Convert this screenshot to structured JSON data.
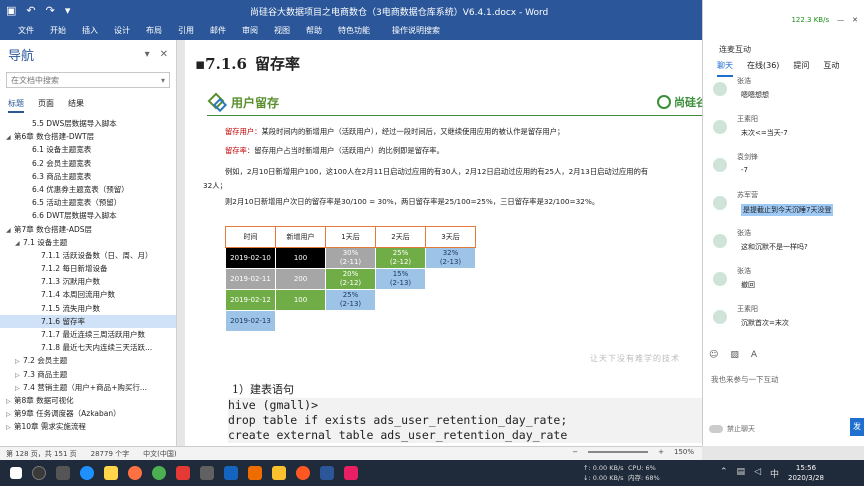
{
  "window": {
    "title": "尚硅谷大数据项目之电商数仓（3电商数据仓库系统）V6.4.1.docx  -  Word"
  },
  "ribbon": {
    "tabs": [
      "文件",
      "开始",
      "插入",
      "设计",
      "布局",
      "引用",
      "邮件",
      "审阅",
      "视图",
      "帮助",
      "特色功能"
    ],
    "tell_me": "操作说明搜索"
  },
  "nav": {
    "title": "导航",
    "search_placeholder": "在文档中搜索",
    "tabs": [
      "标题",
      "页面",
      "结果"
    ],
    "items": [
      {
        "label": "5.5 DWS层数据导入脚本",
        "indent": 2,
        "tri": ""
      },
      {
        "label": "第6章 数仓搭建-DWT层",
        "indent": 0,
        "tri": "◢"
      },
      {
        "label": "6.1 设备主题宽表",
        "indent": 2,
        "tri": ""
      },
      {
        "label": "6.2 会员主题宽表",
        "indent": 2,
        "tri": ""
      },
      {
        "label": "6.3 商品主题宽表",
        "indent": 2,
        "tri": ""
      },
      {
        "label": "6.4 优惠券主题宽表（预留）",
        "indent": 2,
        "tri": ""
      },
      {
        "label": "6.5 活动主题宽表（预留）",
        "indent": 2,
        "tri": ""
      },
      {
        "label": "6.6 DWT层数据导入脚本",
        "indent": 2,
        "tri": ""
      },
      {
        "label": "第7章 数仓搭建-ADS层",
        "indent": 0,
        "tri": "◢"
      },
      {
        "label": "7.1 设备主题",
        "indent": 1,
        "tri": "◢"
      },
      {
        "label": "7.1.1 活跃设备数（日、周、月）",
        "indent": 3,
        "tri": ""
      },
      {
        "label": "7.1.2 每日新增设备",
        "indent": 3,
        "tri": ""
      },
      {
        "label": "7.1.3 沉默用户数",
        "indent": 3,
        "tri": ""
      },
      {
        "label": "7.1.4 本周回流用户数",
        "indent": 3,
        "tri": ""
      },
      {
        "label": "7.1.5 流失用户数",
        "indent": 3,
        "tri": ""
      },
      {
        "label": "7.1.6 留存率",
        "indent": 3,
        "tri": "",
        "selected": true
      },
      {
        "label": "7.1.7 最近连续三周活跃用户数",
        "indent": 3,
        "tri": ""
      },
      {
        "label": "7.1.8 最近七天内连续三天活跃...",
        "indent": 3,
        "tri": ""
      },
      {
        "label": "7.2 会员主题",
        "indent": 1,
        "tri": "▷"
      },
      {
        "label": "7.3 商品主题",
        "indent": 1,
        "tri": "▷"
      },
      {
        "label": "7.4 营销主题（用户+商品+购买行...",
        "indent": 1,
        "tri": "▷"
      },
      {
        "label": "第8章 数据可视化",
        "indent": 0,
        "tri": "▷"
      },
      {
        "label": "第9章 任务调度器（Azkaban）",
        "indent": 0,
        "tri": "▷"
      },
      {
        "label": "第10章 需求实施流程",
        "indent": 0,
        "tri": "▷"
      }
    ]
  },
  "doc": {
    "heading_num": "7.1.6",
    "heading_text": "留存率",
    "banner_title": "用户留存",
    "logo_text": "尚硅谷",
    "p1_term": "留存用户：",
    "p1_text": "某段时间内的新增用户（活跃用户），经过一段时间后，又继续使用应用的被认作是留存用户；",
    "p2_term": "留存率：",
    "p2_text": "留存用户占当时新增用户（活跃用户）的比例即是留存率。",
    "p3a": "例如，2月10日新增用户100，这100人在2月11日启动过应用的有30人，2月12日启动过应用的有25人，2月13日启动过应用的有",
    "p3b": "32人；",
    "p4": "则2月10日新增用户次日的留存率是30/100 = 30%，两日留存率是25/100=25%，三日留存率是32/100=32%。",
    "table_headers": [
      "时间",
      "新增用户",
      "1天后",
      "2天后",
      "3天后"
    ],
    "table_rows": [
      {
        "date": "2019-02-10",
        "new": "100",
        "d1": "30%\n(2-11)",
        "d2": "25%\n(2-12)",
        "d3": "32%\n(2-13)"
      },
      {
        "date": "2019-02-11",
        "new": "200",
        "d1": "20%\n(2-12)",
        "d2": "15%\n(2-13)",
        "d3": ""
      },
      {
        "date": "2019-02-12",
        "new": "100",
        "d1": "25%\n(2-13)",
        "d2": "",
        "d3": ""
      },
      {
        "date": "2019-02-13",
        "new": "",
        "d1": "",
        "d2": "",
        "d3": ""
      }
    ],
    "watermark": "让天下没有难学的技术",
    "section": "1）建表语句",
    "code": [
      "hive (gmall)>",
      "drop table if exists ads_user_retention_day_rate;",
      "create external table ads_user_retention_day_rate"
    ]
  },
  "chat": {
    "net_speed": "122.3 KB/s",
    "title": "连麦互动",
    "tabs": [
      "聊天",
      "在线(36)",
      "提问",
      "互动"
    ],
    "messages": [
      {
        "who": "张浩",
        "text": "嗯嗯想想",
        "hl": false
      },
      {
        "who": "王素阳",
        "text": "末次<=当天-7",
        "hl": false
      },
      {
        "who": "袁剑锋",
        "text": "-7",
        "hl": false
      },
      {
        "who": "苏军营",
        "text": "是提截止到今天沉睡7天没登",
        "hl": true
      },
      {
        "who": "张浩",
        "text": "这和沉默不是一样吗?",
        "hl": false
      },
      {
        "who": "张浩",
        "text": "撤回",
        "hl": false
      },
      {
        "who": "王素阳",
        "text": "沉默首次=末次",
        "hl": false
      }
    ],
    "input_placeholder": "我也来参与一下互动",
    "mute_label": "禁止聊天",
    "send": "发"
  },
  "status": {
    "page": "第 128 页，共 151 页",
    "words": "28779 个字",
    "lang": "中文(中国)",
    "zoom": "150%"
  },
  "taskbar": {
    "up": "↑: 0.00 KB/s",
    "down": "↓: 0.00 KB/s",
    "cpu": "CPU: 6%",
    "mem": "内存: 68%",
    "ime": "中",
    "time": "15:56",
    "date": "2020/3/28"
  }
}
